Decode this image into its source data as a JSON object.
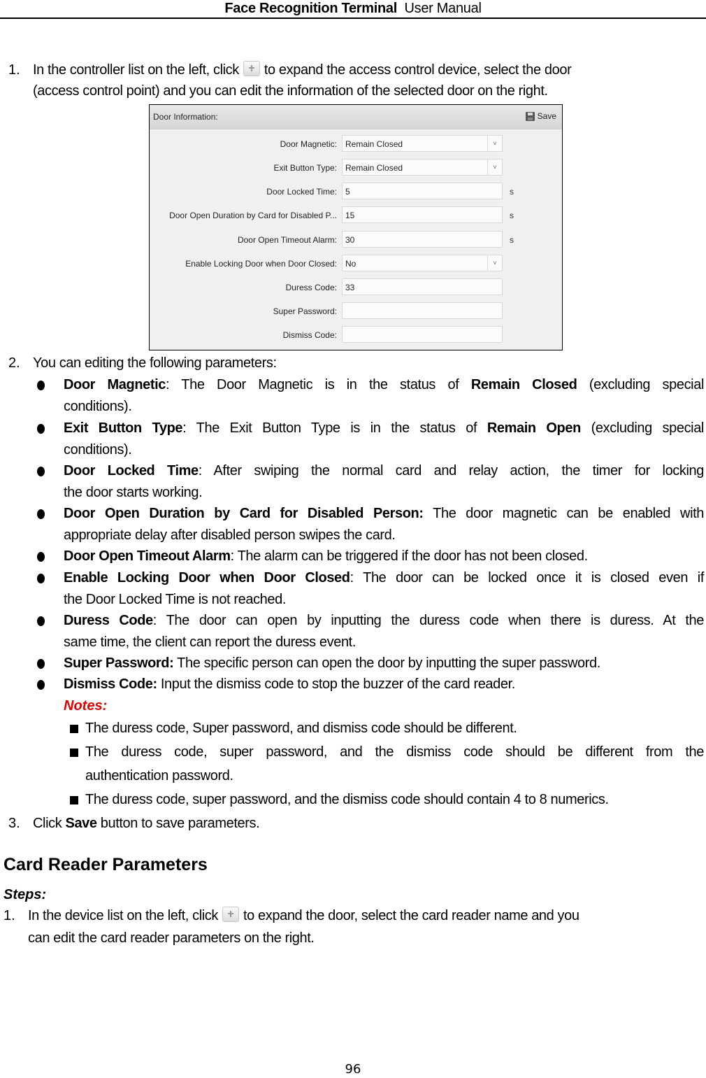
{
  "header": {
    "title_bold": "Face Recognition Terminal",
    "title_rest": "User Manual"
  },
  "step1": {
    "number": "1.",
    "line1_before": "In the controller list on the left, click",
    "line1_after": "to expand the access control device, select the door",
    "line2": "(access control point) and you can edit the information of the selected door on the right.",
    "icon": "plus-icon"
  },
  "panel": {
    "title": "Door Information:",
    "save_label": "Save",
    "fields": [
      {
        "label": "Door Magnetic:",
        "value": "Remain Closed",
        "type": "select",
        "unit": ""
      },
      {
        "label": "Exit Button Type:",
        "value": "Remain Closed",
        "type": "select",
        "unit": ""
      },
      {
        "label": "Door Locked Time:",
        "value": "5",
        "type": "text",
        "unit": "s"
      },
      {
        "label": "Door Open Duration by Card for Disabled P...",
        "value": "15",
        "type": "text",
        "unit": "s"
      },
      {
        "label": "Door Open Timeout Alarm:",
        "value": "30",
        "type": "text",
        "unit": "s"
      },
      {
        "label": "Enable Locking Door when Door Closed:",
        "value": "No",
        "type": "select",
        "unit": ""
      },
      {
        "label": "Duress Code:",
        "value": "33",
        "type": "text",
        "unit": ""
      },
      {
        "label": "Super Password:",
        "value": "",
        "type": "text",
        "unit": ""
      },
      {
        "label": "Dismiss Code:",
        "value": "",
        "type": "text",
        "unit": ""
      }
    ]
  },
  "step2": {
    "number": "2.",
    "text": "You can editing the following parameters:",
    "bullets": [
      {
        "term": "Door Magnetic",
        "sep": ":",
        "line1": " The Door Magnetic is in the status of ",
        "bold2": "Remain Closed",
        "line1_end": " (excluding special",
        "line2": "conditions)."
      },
      {
        "term": "Exit Button Type",
        "sep": ":",
        "line1": " The Exit Button Type is in the status of ",
        "bold2": "Remain Open",
        "line1_end": " (excluding special",
        "line2": "conditions)."
      },
      {
        "term": "Door Locked Time",
        "sep": ":",
        "line1": " After swiping the normal card and relay action, the timer for locking",
        "line2": "the door starts working."
      },
      {
        "term": "Door Open Duration by Card for Disabled Person:",
        "sep": "",
        "line1": " The door magnetic can be enabled with",
        "line2": "appropriate delay after disabled person swipes the card."
      },
      {
        "term": "Door Open Timeout Alarm",
        "sep": ":",
        "line1": " The alarm can be triggered if the door has not been closed.",
        "line2": ""
      },
      {
        "term": "Enable Locking Door when Door Closed",
        "sep": ":",
        "line1": " The door can be locked once it is closed even if",
        "line2": "the Door Locked Time is not reached."
      },
      {
        "term": "Duress Code",
        "sep": ":",
        "line1": " The door can open by inputting the duress code when there is duress. At the",
        "line2": "same time, the client can report the duress event."
      },
      {
        "term": "Super Password:",
        "sep": "",
        "line1": " The specific person can open the door by inputting the super password.",
        "line2": ""
      },
      {
        "term": "Dismiss Code:",
        "sep": "",
        "line1": " Input the dismiss code to stop the buzzer of the card reader.",
        "line2": ""
      }
    ]
  },
  "notes": {
    "title": "Notes:",
    "items": [
      {
        "line1": "The duress code, Super password, and dismiss code should be different.",
        "line2": ""
      },
      {
        "line1": "The duress code, super password, and the dismiss code should be different from the",
        "line2": "authentication password."
      },
      {
        "line1": "The duress code, super password, and the dismiss code should contain 4 to 8 numerics.",
        "line2": ""
      }
    ]
  },
  "step3": {
    "number": "3.",
    "before": "Click ",
    "bold": "Save",
    "after": " button to save parameters."
  },
  "section": {
    "title": "Card Reader Parameters",
    "steps_label": "Steps:",
    "step1_number": "1.",
    "step1_line1_before": "In the device list on the left, click",
    "step1_line1_after": "to expand the door, select the card reader name and you",
    "step1_line2": "can edit the card reader parameters on the right."
  },
  "page_number": "96"
}
